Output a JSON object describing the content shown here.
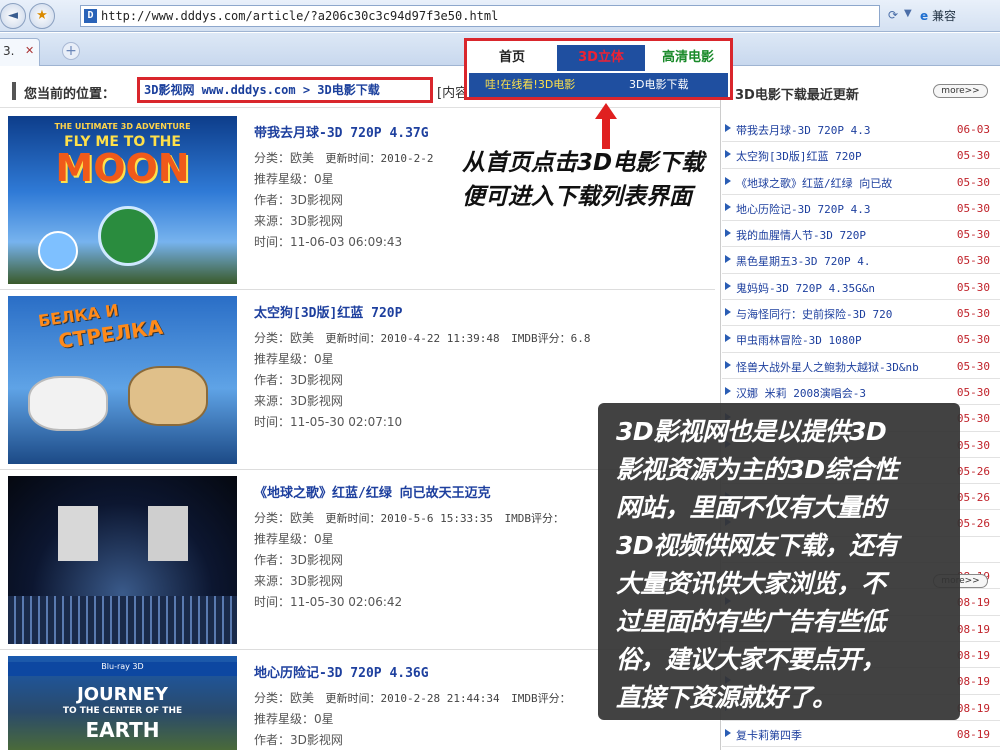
{
  "browser": {
    "url": "http://www.dddys.com/article/?a206c30c3c94d97f3e50.html",
    "compat_label": "兼容",
    "tab_label": "3."
  },
  "breadcrumb": {
    "label": "您当前的位置：",
    "path": "3D影视网 www.dddys.com > 3D电影下载",
    "tail": "[内容"
  },
  "site_nav": {
    "tabs": [
      "首页",
      "3D立体",
      "高清电影"
    ],
    "sub_items": [
      "哇!在线看!3D电影",
      "3D电影下载"
    ]
  },
  "articles": [
    {
      "title": "带我去月球-3D 720P 4.37G",
      "category": "分类：欧美",
      "updated": "更新时间：2010-2-2",
      "imdb": "",
      "rating": "推荐星级：0星",
      "author": "作者：3D影视网",
      "source": "来源：3D影视网",
      "time": "时间：11-06-03 06:09:43",
      "poster_line1": "THE ULTIMATE 3D ADVENTURE",
      "poster_line2": "FLY ME TO THE",
      "poster_line3": "MOON"
    },
    {
      "title": "太空狗[3D版]红蓝 720P",
      "category": "分类：欧美",
      "updated": "更新时间：2010-4-22 11:39:48",
      "imdb": "IMDB评分：6.8",
      "rating": "推荐星级：0星",
      "author": "作者：3D影视网",
      "source": "来源：3D影视网",
      "time": "时间：11-05-30 02:07:10",
      "poster_line1": "БЕЛКА И",
      "poster_line2": "СТРЕЛКА",
      "poster_line3": ""
    },
    {
      "title": "《地球之歌》红蓝/红绿 向已故天王迈克",
      "category": "分类：欧美",
      "updated": "更新时间：2010-5-6 15:33:35",
      "imdb": "IMDB评分：",
      "rating": "推荐星级：0星",
      "author": "作者：3D影视网",
      "source": "来源：3D影视网",
      "time": "时间：11-05-30 02:06:42",
      "poster_line1": "",
      "poster_line2": "",
      "poster_line3": ""
    },
    {
      "title": "地心历险记-3D 720P 4.36G",
      "category": "分类：欧美",
      "updated": "更新时间：2010-2-28 21:44:34",
      "imdb": "IMDB评分：",
      "rating": "推荐星级：0星",
      "author": "作者：3D影视网",
      "source": "",
      "time": "",
      "poster_line1": "JOURNEY",
      "poster_line2": "TO THE CENTER OF THE",
      "poster_line3": "EARTH"
    }
  ],
  "sidebar": {
    "title": "3D电影下载最近更新",
    "more_label": "more>>",
    "items": [
      {
        "title": "带我去月球-3D 720P 4.3",
        "date": "06-03"
      },
      {
        "title": "太空狗[3D版]红蓝 720P",
        "date": "05-30"
      },
      {
        "title": "《地球之歌》红蓝/红绿 向已故",
        "date": "05-30"
      },
      {
        "title": "地心历险记-3D 720P 4.3",
        "date": "05-30"
      },
      {
        "title": "我的血腥情人节-3D 720P",
        "date": "05-30"
      },
      {
        "title": "黑色星期五3-3D 720P 4.",
        "date": "05-30"
      },
      {
        "title": "鬼妈妈-3D 720P 4.35G&n",
        "date": "05-30"
      },
      {
        "title": "与海怪同行：史前探险-3D 720",
        "date": "05-30"
      },
      {
        "title": "甲虫雨林冒险-3D 1080P",
        "date": "05-30"
      },
      {
        "title": "怪兽大战外星人之鲍勃大越狱-3D&nb",
        "date": "05-30"
      },
      {
        "title": "汉娜 米莉 2008演唱会-3",
        "date": "05-30"
      },
      {
        "title": "",
        "date": "05-30"
      },
      {
        "title": "",
        "date": "05-30"
      },
      {
        "title": "",
        "date": "05-26"
      },
      {
        "title": "",
        "date": "05-26"
      },
      {
        "title": "",
        "date": "05-26"
      },
      {
        "title": "",
        "date": ""
      },
      {
        "title": "",
        "date": "08-19"
      },
      {
        "title": "",
        "date": "08-19"
      },
      {
        "title": "",
        "date": "08-19"
      },
      {
        "title": "",
        "date": "08-19"
      },
      {
        "title": "",
        "date": "08-19"
      },
      {
        "title": "",
        "date": "08-19"
      },
      {
        "title": "复卡莉第四季",
        "date": "08-19"
      }
    ]
  },
  "annotations": {
    "callout_arrow_text_line1": "从首页点击3D电影下载",
    "callout_arrow_text_line2": "便可进入下载列表界面",
    "callout_box_lines": [
      "3D影视网也是以提供3D",
      "影视资源为主的3D综合性",
      "网站，里面不仅有大量的",
      "3D视频供网友下载，还有",
      "大量资讯供大家浏览，不",
      "过里面的有些广告有些低",
      "俗，建议大家不要点开，",
      "直接下资源就好了。"
    ]
  },
  "colors": {
    "highlight_red": "#d9262c",
    "link_blue": "#1d3f9e",
    "date_red": "#c0222a",
    "nav_blue": "#1f4fa0",
    "nav_green": "#1a8a2a"
  }
}
